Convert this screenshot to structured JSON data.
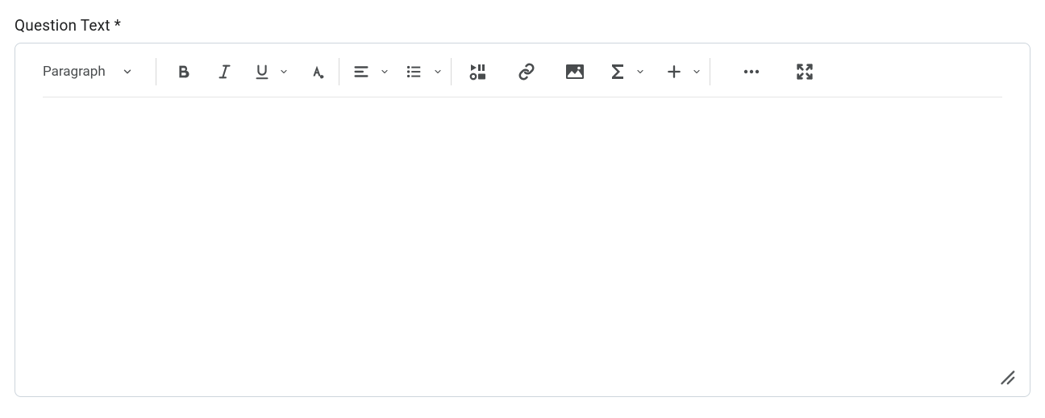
{
  "field": {
    "label": "Question Text *"
  },
  "toolbar": {
    "paragraph_label": "Paragraph"
  }
}
